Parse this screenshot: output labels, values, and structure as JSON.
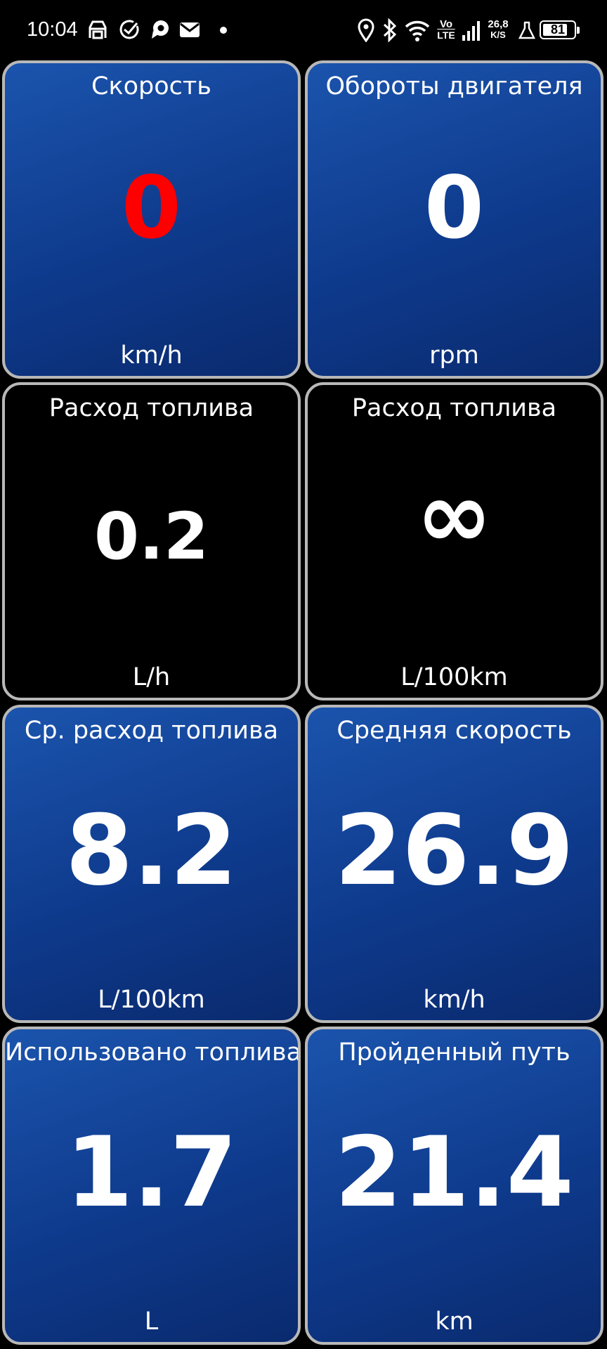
{
  "status_bar": {
    "time": "10:04",
    "left_icons": [
      "car-icon",
      "check-circle-icon",
      "chat-bubble-icon",
      "mail-icon",
      "dot-icon"
    ],
    "right_icons": [
      "location-icon",
      "bluetooth-icon",
      "wifi-icon",
      "volte-icon",
      "signal-icon",
      "data-speed-icon",
      "flask-icon",
      "battery-icon"
    ],
    "volte_top": "Vo",
    "volte_bottom": "LTE",
    "data_speed_value": "26,8",
    "data_speed_unit": "K/S",
    "battery_level": "81",
    "battery_fraction": 0.81
  },
  "colors": {
    "tile_border": "#b8b8b8",
    "tile_blue": "#1b54ad",
    "tile_black": "#000000",
    "value_alert": "#ff0000",
    "value_normal": "#ffffff"
  },
  "tiles": [
    {
      "title": "Скорость",
      "value": "0",
      "unit": "km/h",
      "style": "blue",
      "value_color": "#ff0000"
    },
    {
      "title": "Обороты двигателя",
      "value": "0",
      "unit": "rpm",
      "style": "blue",
      "value_color": "#ffffff"
    },
    {
      "title": "Расход топлива",
      "value": "0.2",
      "unit": "L/h",
      "style": "black",
      "value_color": "#ffffff"
    },
    {
      "title": "Расход топлива",
      "value": "∞",
      "unit": "L/100km",
      "style": "black",
      "value_color": "#ffffff"
    },
    {
      "title": "Ср. расход топлива",
      "value": "8.2",
      "unit": "L/100km",
      "style": "blue",
      "value_color": "#ffffff"
    },
    {
      "title": "Средняя скорость",
      "value": "26.9",
      "unit": "km/h",
      "style": "blue",
      "value_color": "#ffffff"
    },
    {
      "title": "Использовано топлива",
      "value": "1.7",
      "unit": "L",
      "style": "blue",
      "value_color": "#ffffff"
    },
    {
      "title": "Пройденный путь",
      "value": "21.4",
      "unit": "km",
      "style": "blue",
      "value_color": "#ffffff"
    }
  ]
}
